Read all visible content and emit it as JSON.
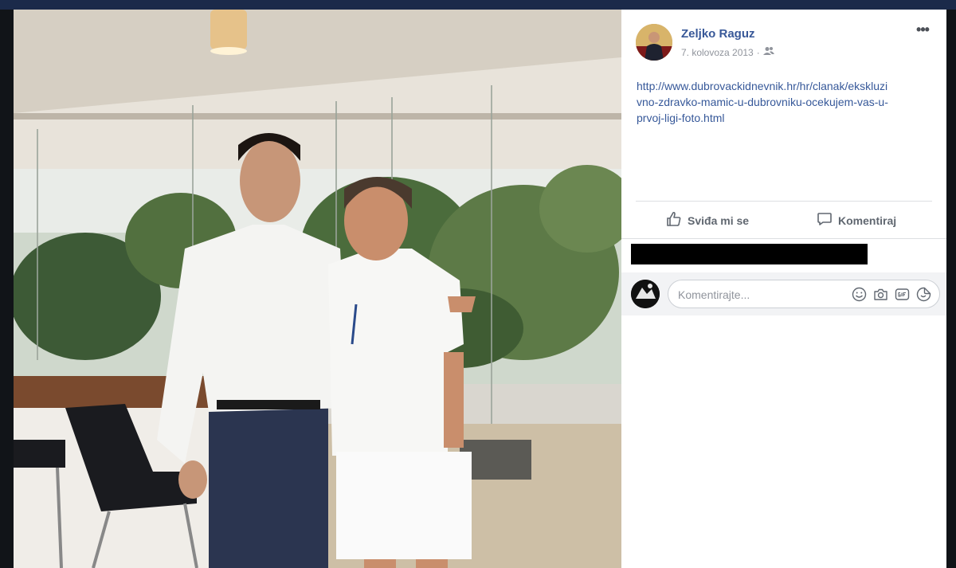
{
  "post": {
    "author": "Zeljko Raguz",
    "date": "7. kolovoza 2013",
    "separator": "·",
    "audience_icon": "friends-icon",
    "more_icon": "more-options-icon",
    "more_label": "•••",
    "link_text": "http://www.dubrovackidnevnik.hr/hr/clanak/ekskluzivno-zdravko-mamic-u-dubrovniku-ocekujem-vas-u-prvoj-ligi-foto.html"
  },
  "actions": {
    "like_label": "Sviđa mi se",
    "comment_label": "Komentiraj"
  },
  "comment_box": {
    "placeholder": "Komentirajte..."
  },
  "colors": {
    "link": "#365899",
    "author": "#385898",
    "muted": "#90949c",
    "action": "#606770"
  }
}
